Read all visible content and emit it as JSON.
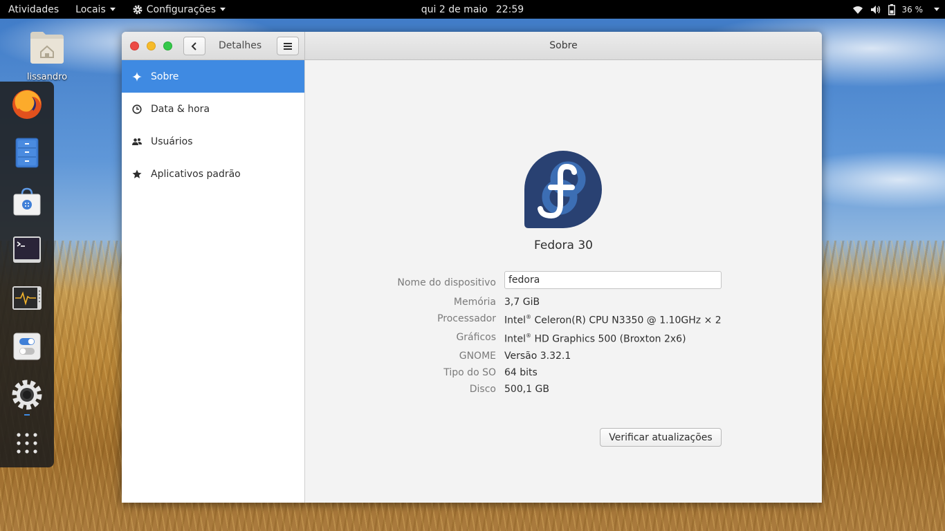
{
  "topbar": {
    "activities": "Atividades",
    "places": "Locais",
    "app_menu": "Configurações",
    "date": "qui 2 de maio",
    "time": "22:59",
    "battery": "36 %"
  },
  "desktop": {
    "home_folder_label": "lissandro"
  },
  "dock": {
    "items": [
      "firefox-icon",
      "files-icon",
      "software-icon",
      "terminal-icon",
      "system-monitor-icon",
      "tweaks-icon",
      "settings-icon",
      "show-apps-icon"
    ]
  },
  "window": {
    "sidebar_title": "Detalhes",
    "content_title": "Sobre",
    "sidebar": {
      "items": [
        {
          "label": "Sobre",
          "icon": "sparkle-icon",
          "active": true
        },
        {
          "label": "Data & hora",
          "icon": "clock-icon",
          "active": false
        },
        {
          "label": "Usuários",
          "icon": "users-icon",
          "active": false
        },
        {
          "label": "Aplicativos padrão",
          "icon": "star-icon",
          "active": false
        }
      ]
    },
    "about": {
      "os_name": "Fedora 30",
      "device_name_label": "Nome do dispositivo",
      "device_name_value": "fedora",
      "memory_label": "Memória",
      "memory_value": "3,7 GiB",
      "processor_label": "Processador",
      "processor_brand": "Intel",
      "processor_mark": "®",
      "processor_value": " Celeron(R) CPU N3350 @ 1.10GHz × 2",
      "graphics_label": "Gráficos",
      "graphics_brand": "Intel",
      "graphics_mark": "®",
      "graphics_value": " HD Graphics 500 (Broxton 2x6)",
      "gnome_label": "GNOME",
      "gnome_value": "Versão 3.32.1",
      "os_type_label": "Tipo do SO",
      "os_type_value": "64 bits",
      "disk_label": "Disco",
      "disk_value": "500,1 GB",
      "update_button": "Verificar atualizações"
    }
  },
  "colors": {
    "selection": "#3f8ae2",
    "fedora_blue": "#294172",
    "fedora_light": "#3c6eb4"
  }
}
